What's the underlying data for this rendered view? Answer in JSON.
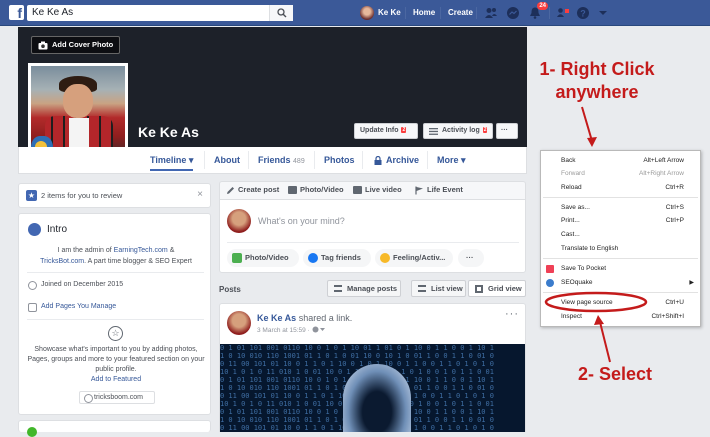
{
  "topbar": {
    "logo": "f",
    "search_value": "Ke Ke As",
    "user_name": "Ke Ke",
    "home": "Home",
    "create": "Create",
    "notification_count": "24"
  },
  "cover": {
    "add_cover_label": "Add Cover Photo",
    "profile_name": "Ke Ke As",
    "update_info": "Update Info",
    "update_info_tag": "2",
    "activity_log": "Activity log",
    "activity_log_tag": "2",
    "more_dots": "···"
  },
  "tabs": {
    "timeline": "Timeline ▾",
    "about": "About",
    "friends": "Friends",
    "friends_count": "489",
    "photos": "Photos",
    "archive": "Archive",
    "more": "More ▾"
  },
  "review": {
    "text": "2 items for you to review",
    "close": "×"
  },
  "intro": {
    "title": "Intro",
    "bio_line1_pre": "I am the admin of ",
    "bio_link1": "EarningTech.com",
    "bio_line1_post": " &",
    "bio_link2": "TricksBot.com",
    "bio_line2_post": ". A part time blogger & SEO Expert",
    "joined": "Joined on December 2015",
    "manage": "Add Pages You Manage",
    "showcase": "Showcase what's important to you by adding photos, Pages, groups and more to your featured section on your public profile.",
    "add_featured": "Add to Featured",
    "website": "tricksboom.com"
  },
  "composer": {
    "tab_create": "Create post",
    "tab_photo": "Photo/Video",
    "tab_live": "Live video",
    "tab_life": "Life Event",
    "placeholder": "What's on your mind?",
    "btn_photo": "Photo/Video",
    "btn_tag": "Tag friends",
    "btn_feeling": "Feeling/Activ...",
    "btn_more": "···"
  },
  "posts": {
    "label": "Posts",
    "manage": "Manage posts",
    "list_view": "List view",
    "grid_view": "Grid view"
  },
  "post": {
    "author": "Ke Ke As",
    "action": " shared a link.",
    "date": "3 March at 15:59 · ",
    "dots": "···"
  },
  "context_menu": {
    "items": [
      {
        "label": "Back",
        "shortcut": "Alt+Left Arrow"
      },
      {
        "label": "Forward",
        "shortcut": "Alt+Right Arrow"
      },
      {
        "label": "Reload",
        "shortcut": "Ctrl+R"
      },
      {
        "label": "Save as...",
        "shortcut": "Ctrl+S"
      },
      {
        "label": "Print...",
        "shortcut": "Ctrl+P"
      },
      {
        "label": "Cast...",
        "shortcut": ""
      },
      {
        "label": "Translate to English",
        "shortcut": ""
      },
      {
        "label": "Save To Pocket",
        "shortcut": ""
      },
      {
        "label": "SEOquake",
        "shortcut": ""
      },
      {
        "label": "View page source",
        "shortcut": "Ctrl+U"
      },
      {
        "label": "Inspect",
        "shortcut": "Ctrl+Shift+I"
      }
    ]
  },
  "annotations": {
    "step1_line1": "1- Right Click",
    "step1_line2": "anywhere",
    "step2": "2- Select",
    "color": "#c41b1b"
  },
  "colors": {
    "facebook_blue": "#3b5998",
    "link_blue": "#365899",
    "background": "#e9ebee"
  }
}
